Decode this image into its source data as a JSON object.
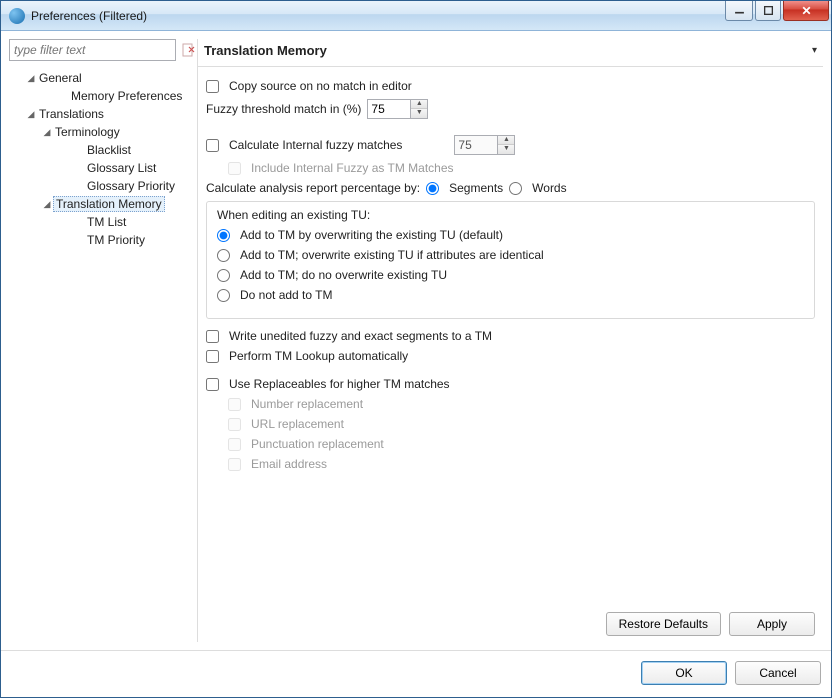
{
  "window": {
    "title": "Preferences (Filtered)"
  },
  "filter": {
    "placeholder": "type filter text"
  },
  "tree": {
    "general": "General",
    "memoryPrefs": "Memory Preferences",
    "translations": "Translations",
    "terminology": "Terminology",
    "blacklist": "Blacklist",
    "glossaryList": "Glossary List",
    "glossaryPriority": "Glossary Priority",
    "translationMemory": "Translation Memory",
    "tmList": "TM List",
    "tmPriority": "TM Priority"
  },
  "header": {
    "title": "Translation Memory"
  },
  "opts": {
    "copySource": "Copy source on no match in editor",
    "fuzzyThresholdLabel": "Fuzzy threshold match in (%)",
    "fuzzyThresholdValue": "75",
    "calcInternal": "Calculate Internal fuzzy matches",
    "calcInternalValue": "75",
    "includeInternal": "Include Internal Fuzzy as TM Matches",
    "calcAnalysisLabel": "Calculate analysis report percentage by:",
    "segments": "Segments",
    "words": "Words",
    "editingExistingLabel": "When editing an existing TU:",
    "r1": "Add to TM by overwriting the existing TU (default)",
    "r2": "Add to TM; overwrite existing TU if attributes are identical",
    "r3": "Add to TM; do no overwrite existing TU",
    "r4": "Do not add to TM",
    "writeUnedited": "Write unedited fuzzy and exact segments to a TM",
    "performLookup": "Perform TM Lookup automatically",
    "useReplaceables": "Use Replaceables for higher TM matches",
    "numberRepl": "Number replacement",
    "urlRepl": "URL replacement",
    "punctRepl": "Punctuation replacement",
    "emailRepl": "Email address"
  },
  "buttons": {
    "restore": "Restore Defaults",
    "apply": "Apply",
    "ok": "OK",
    "cancel": "Cancel"
  }
}
